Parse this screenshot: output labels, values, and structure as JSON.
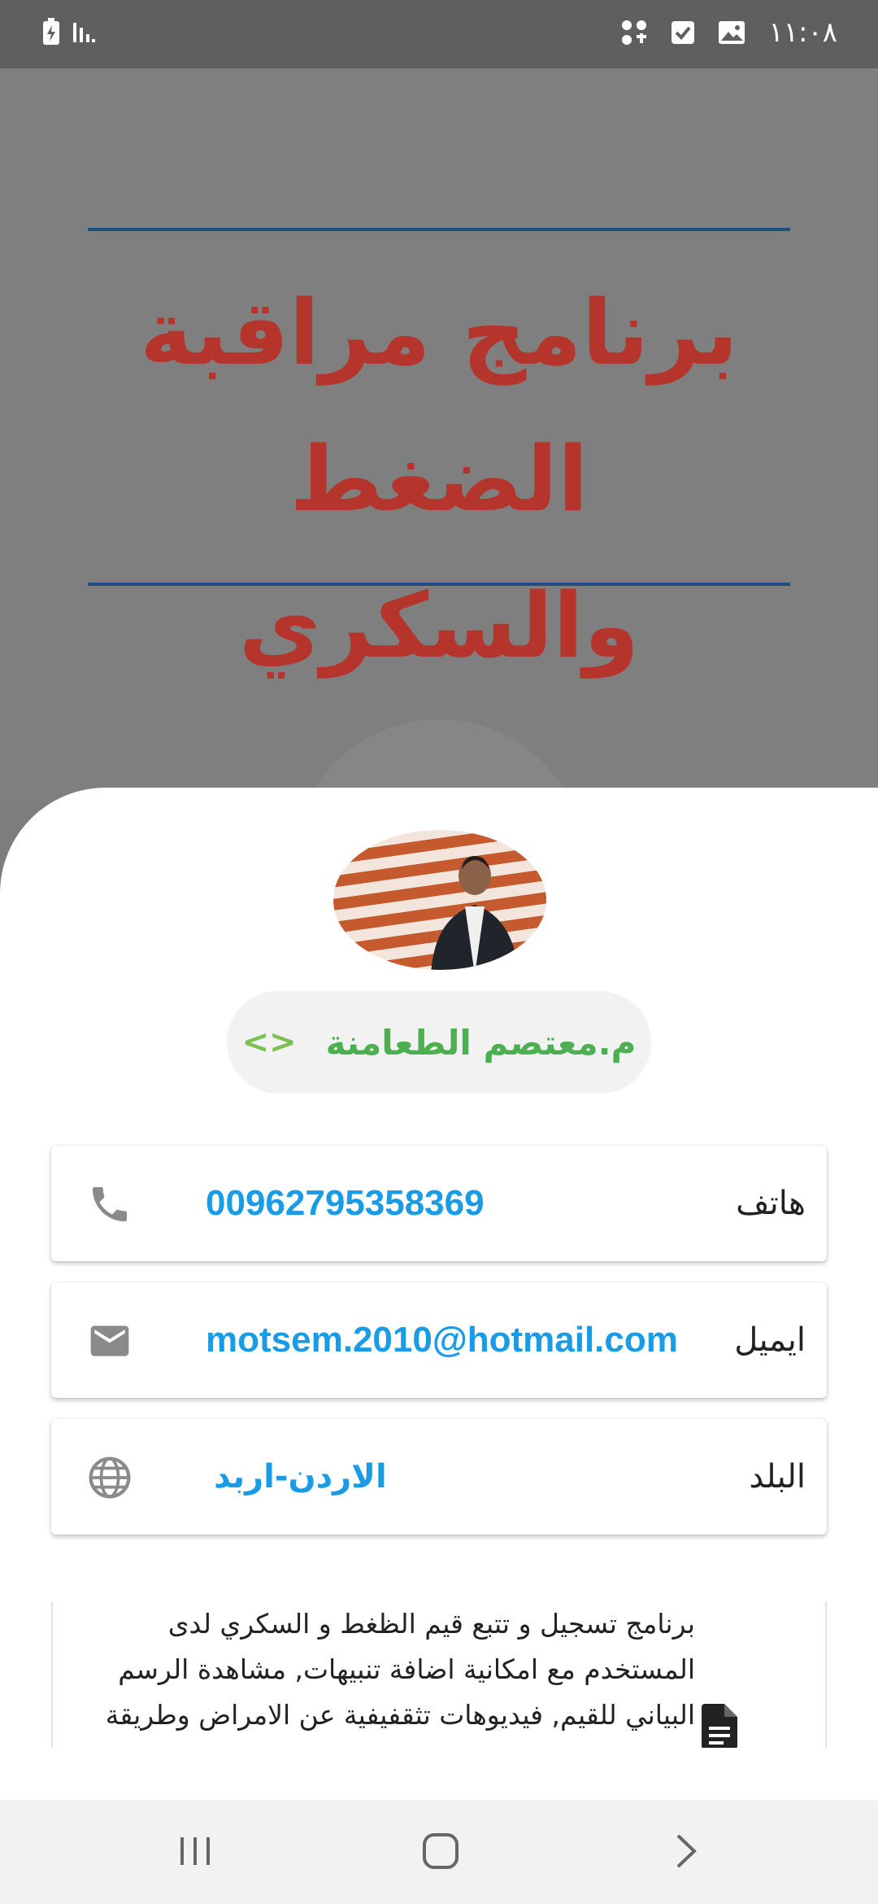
{
  "status_bar": {
    "time": "١١:٠٨",
    "left_icons": [
      "battery-charging-icon",
      "signal-icon"
    ],
    "right_icons": [
      "gallery-icon",
      "checkbox-icon",
      "app-grid-icon"
    ]
  },
  "splash": {
    "title_line1": "برنامج مراقبة",
    "title_line2": "الضغط والسكري",
    "title_color": "#b5342b",
    "rule_color": "#1f4e80"
  },
  "profile": {
    "name": "م.معتصم الطعامنة",
    "name_color": "#4caf50"
  },
  "contacts": [
    {
      "label": "هاتف",
      "value": "00962795358369",
      "icon": "phone-icon"
    },
    {
      "label": "ايميل",
      "value": "motsem.2010@hotmail.com",
      "icon": "mail-icon"
    },
    {
      "label": "البلد",
      "value": "الاردن-اربد",
      "icon": "globe-icon"
    }
  ],
  "accent_color": "#1a9be6",
  "about": {
    "line1": "برنامج تسجيل و تتبع قيم الظغط و السكري لدى",
    "line2": "المستخدم مع امكانية اضافة تنبيهات, مشاهدة الرسم",
    "line3": "البياني للقيم, فيديوهات تثقفيفية عن الامراض وطريقة"
  },
  "navbar": {
    "buttons": [
      "recents-icon",
      "home-icon",
      "back-icon"
    ]
  }
}
